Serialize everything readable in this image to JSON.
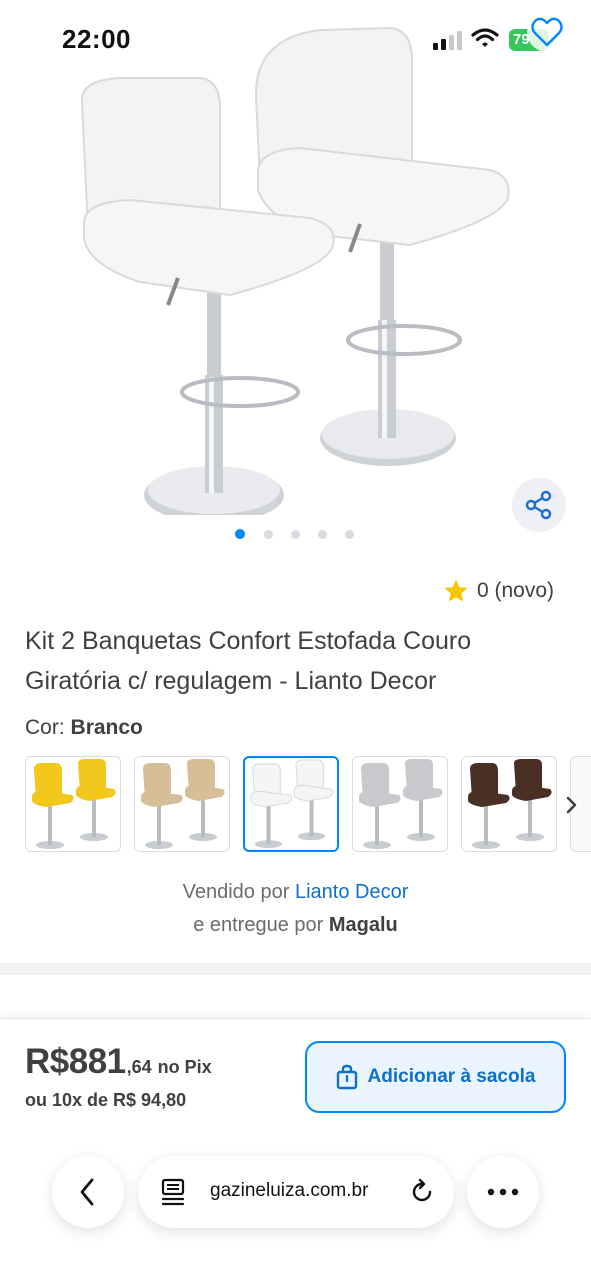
{
  "status_bar": {
    "time": "22:00",
    "battery": "79",
    "icons": [
      "signal-icon",
      "wifi-icon",
      "battery-charging-icon"
    ]
  },
  "product": {
    "favorite_icon": "heart-outline-icon",
    "share_icon": "share-icon",
    "carousel": {
      "count": 5,
      "active_index": 0
    },
    "rating": {
      "value": "0 (novo)",
      "icon": "star-icon",
      "star_color": "#f6c400"
    },
    "title_line1": "Kit 2 Banquetas Confort Estofada Couro",
    "title_line2": "Giratória c/ regulagem - Lianto Decor",
    "color_label": "Cor:",
    "color_value": "Branco",
    "swatches": [
      {
        "color": "#f2c81c",
        "selected": false
      },
      {
        "color": "#d6bf98",
        "selected": false
      },
      {
        "color": "#f5f5f5",
        "selected": true
      },
      {
        "color": "#c7c9cc",
        "selected": false
      },
      {
        "color": "#4a2f24",
        "selected": false
      }
    ],
    "sold_by_prefix": "Vendido por",
    "seller": "Lianto Decor",
    "delivered_by_prefix": "e entregue por",
    "deliverer": "Magalu"
  },
  "purchase": {
    "price_main": "R$881",
    "price_cents": ",64",
    "price_suffix": "no Pix",
    "installments": "ou 10x de R$ 94,80",
    "add_to_bag_label": "Adicionar à sacola",
    "add_to_bag_icon": "shopping-bag-icon"
  },
  "browser": {
    "url": "gazineluiza.com.br",
    "back_icon": "chevron-left-icon",
    "tabs_icon": "reader-icon",
    "reload_icon": "reload-icon",
    "more_icon": "more-dots-icon"
  },
  "colors": {
    "accent": "#0086ff",
    "link": "#0f70c9",
    "text": "#404040"
  }
}
